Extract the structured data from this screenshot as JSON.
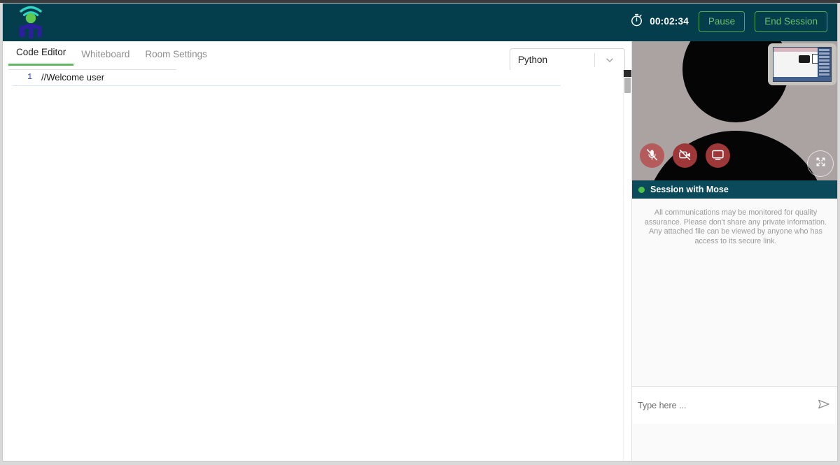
{
  "app": {
    "logo_icon": "tutor-wifi-person-logo"
  },
  "header": {
    "timer_icon": "stopwatch-icon",
    "timer": "00:02:34",
    "pause_label": "Pause",
    "end_session_label": "End Session",
    "bg_color": "#043e4d",
    "accent_green": "#53a353"
  },
  "tabs": [
    {
      "label": "Code Editor",
      "active": true
    },
    {
      "label": "Whiteboard",
      "active": false
    },
    {
      "label": "Room Settings",
      "active": false
    }
  ],
  "language_select": {
    "value": "Python",
    "chevron_icon": "chevron-down-icon"
  },
  "editor": {
    "lines": [
      {
        "number": "1",
        "text": "//Welcome user"
      }
    ]
  },
  "video": {
    "avatar_icon": "user-avatar-silhouette",
    "pip_icon": "self-view-thumbnail",
    "controls": [
      {
        "name": "mic-off-icon",
        "label": "Microphone muted"
      },
      {
        "name": "camera-off-icon",
        "label": "Camera off"
      },
      {
        "name": "screen-share-icon",
        "label": "Share screen"
      }
    ],
    "expand_icon": "expand-fullscreen-icon",
    "control_color": "#9e3737",
    "background_color": "#aba2a2"
  },
  "session": {
    "status_color": "#4cc24c",
    "title": "Session with Mose"
  },
  "chat": {
    "disclaimer": "All communications may be monitored for quality assurance. Please don't share any private information. Any attached file can be viewed by anyone who has access to its secure link.",
    "placeholder": "Type here ...",
    "send_icon": "send-paper-plane-icon"
  }
}
